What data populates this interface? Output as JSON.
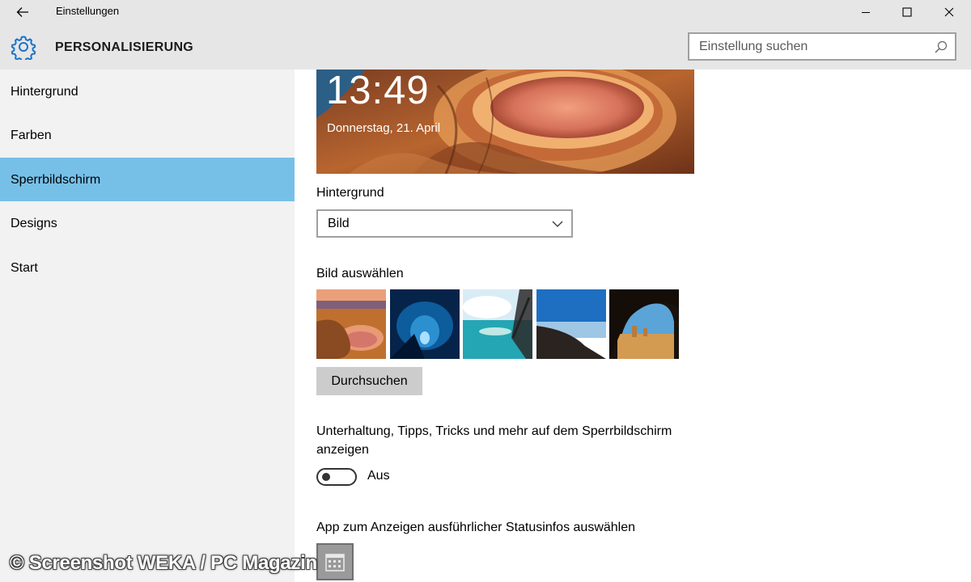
{
  "window": {
    "title": "Einstellungen"
  },
  "header": {
    "title": "PERSONALISIERUNG",
    "search_placeholder": "Einstellung suchen"
  },
  "sidebar": {
    "items": [
      {
        "label": "Hintergrund",
        "active": false
      },
      {
        "label": "Farben",
        "active": false
      },
      {
        "label": "Sperrbildschirm",
        "active": true
      },
      {
        "label": "Designs",
        "active": false
      },
      {
        "label": "Start",
        "active": false
      }
    ]
  },
  "preview": {
    "time": "13:49",
    "date": "Donnerstag, 21. April"
  },
  "background": {
    "label": "Hintergrund",
    "selected": "Bild"
  },
  "picture": {
    "label": "Bild auswählen",
    "browse_label": "Durchsuchen"
  },
  "tips": {
    "label": "Unterhaltung, Tipps, Tricks und mehr auf dem Sperrbildschirm anzeigen",
    "state": "Aus"
  },
  "status": {
    "label": "App zum Anzeigen ausführlicher Statusinfos auswählen"
  },
  "watermark": "© Screenshot WEKA / PC Magazin",
  "colors": {
    "accent": "#76c0e8",
    "header_bg": "#e6e6e6",
    "sidebar_bg": "#f2f2f2"
  }
}
